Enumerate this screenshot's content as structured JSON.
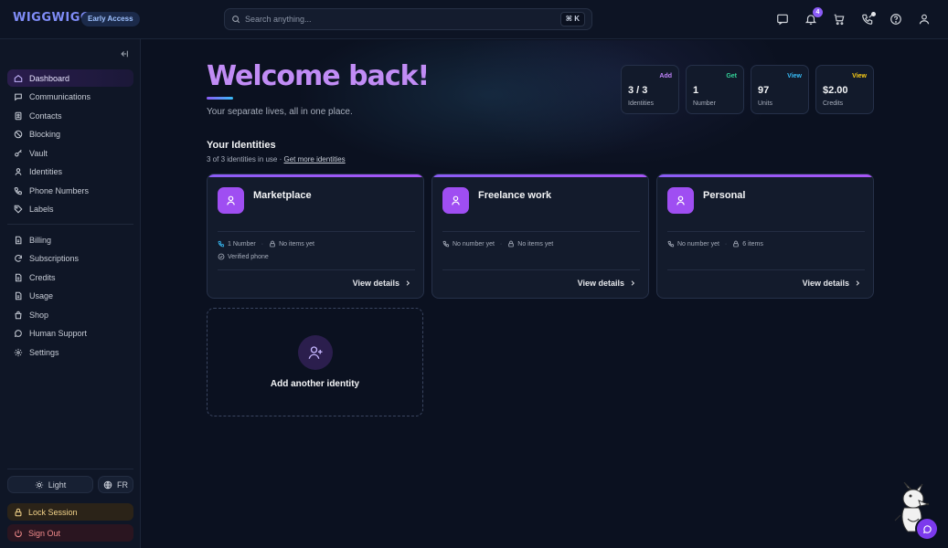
{
  "brand": {
    "name": "WIGGWIGG",
    "badge": "Early Access"
  },
  "search": {
    "placeholder": "Search anything...",
    "shortcut": "⌘ K"
  },
  "topbar": {
    "icons": [
      "messages-icon",
      "bell-icon",
      "cart-icon",
      "call-log-icon",
      "help-icon",
      "user-icon"
    ],
    "notification_count": "4"
  },
  "sidebar": {
    "primary": [
      {
        "label": "Dashboard",
        "icon": "home-icon",
        "active": true
      },
      {
        "label": "Communications",
        "icon": "chat-icon"
      },
      {
        "label": "Contacts",
        "icon": "contacts-icon"
      },
      {
        "label": "Blocking",
        "icon": "block-icon"
      },
      {
        "label": "Vault",
        "icon": "key-icon"
      },
      {
        "label": "Identities",
        "icon": "user-icon"
      },
      {
        "label": "Phone Numbers",
        "icon": "phone-icon"
      },
      {
        "label": "Labels",
        "icon": "tag-icon"
      }
    ],
    "secondary": [
      {
        "label": "Billing",
        "icon": "doc-icon"
      },
      {
        "label": "Subscriptions",
        "icon": "refresh-icon"
      },
      {
        "label": "Credits",
        "icon": "doc-icon"
      },
      {
        "label": "Usage",
        "icon": "doc-icon"
      },
      {
        "label": "Shop",
        "icon": "bag-icon"
      },
      {
        "label": "Human Support",
        "icon": "chat-icon"
      },
      {
        "label": "Settings",
        "icon": "gear-icon"
      }
    ],
    "theme_label": "Light",
    "language_label": "FR",
    "lock_label": "Lock Session",
    "signout_label": "Sign Out"
  },
  "main": {
    "welcome": "Welcome back!",
    "tagline": "Your separate lives, all in one place.",
    "stats": [
      {
        "link": "Add",
        "value": "3 / 3",
        "label": "Identities",
        "color": "#c084fc"
      },
      {
        "link": "Get",
        "value": "1",
        "label": "Number",
        "color": "#34d399"
      },
      {
        "link": "View",
        "value": "97",
        "label": "Units",
        "color": "#38bdf8"
      },
      {
        "link": "View",
        "value": "$2.00",
        "label": "Credits",
        "color": "#facc15"
      }
    ],
    "identities_title": "Your Identities",
    "identities_sub_prefix": "3 of 3 identities in use · ",
    "identities_sub_link": "Get more identities",
    "identities": [
      {
        "name": "Marketplace",
        "number": "1 Number",
        "items": "No items yet",
        "verified": "Verified phone",
        "details": "View details"
      },
      {
        "name": "Freelance work",
        "number": "No number yet",
        "items": "No items yet",
        "details": "View details"
      },
      {
        "name": "Personal",
        "number": "No number yet",
        "items": "6 items",
        "details": "View details"
      }
    ],
    "add_identity": "Add another identity"
  }
}
